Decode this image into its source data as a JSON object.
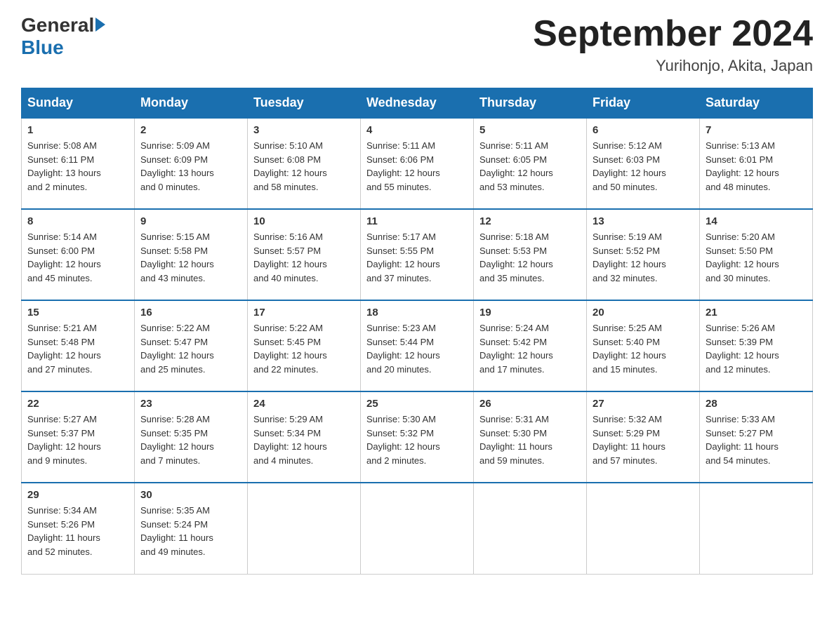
{
  "logo": {
    "general": "General",
    "blue": "Blue"
  },
  "title": "September 2024",
  "subtitle": "Yurihonjo, Akita, Japan",
  "days_of_week": [
    "Sunday",
    "Monday",
    "Tuesday",
    "Wednesday",
    "Thursday",
    "Friday",
    "Saturday"
  ],
  "weeks": [
    [
      {
        "day": "1",
        "info": "Sunrise: 5:08 AM\nSunset: 6:11 PM\nDaylight: 13 hours\nand 2 minutes."
      },
      {
        "day": "2",
        "info": "Sunrise: 5:09 AM\nSunset: 6:09 PM\nDaylight: 13 hours\nand 0 minutes."
      },
      {
        "day": "3",
        "info": "Sunrise: 5:10 AM\nSunset: 6:08 PM\nDaylight: 12 hours\nand 58 minutes."
      },
      {
        "day": "4",
        "info": "Sunrise: 5:11 AM\nSunset: 6:06 PM\nDaylight: 12 hours\nand 55 minutes."
      },
      {
        "day": "5",
        "info": "Sunrise: 5:11 AM\nSunset: 6:05 PM\nDaylight: 12 hours\nand 53 minutes."
      },
      {
        "day": "6",
        "info": "Sunrise: 5:12 AM\nSunset: 6:03 PM\nDaylight: 12 hours\nand 50 minutes."
      },
      {
        "day": "7",
        "info": "Sunrise: 5:13 AM\nSunset: 6:01 PM\nDaylight: 12 hours\nand 48 minutes."
      }
    ],
    [
      {
        "day": "8",
        "info": "Sunrise: 5:14 AM\nSunset: 6:00 PM\nDaylight: 12 hours\nand 45 minutes."
      },
      {
        "day": "9",
        "info": "Sunrise: 5:15 AM\nSunset: 5:58 PM\nDaylight: 12 hours\nand 43 minutes."
      },
      {
        "day": "10",
        "info": "Sunrise: 5:16 AM\nSunset: 5:57 PM\nDaylight: 12 hours\nand 40 minutes."
      },
      {
        "day": "11",
        "info": "Sunrise: 5:17 AM\nSunset: 5:55 PM\nDaylight: 12 hours\nand 37 minutes."
      },
      {
        "day": "12",
        "info": "Sunrise: 5:18 AM\nSunset: 5:53 PM\nDaylight: 12 hours\nand 35 minutes."
      },
      {
        "day": "13",
        "info": "Sunrise: 5:19 AM\nSunset: 5:52 PM\nDaylight: 12 hours\nand 32 minutes."
      },
      {
        "day": "14",
        "info": "Sunrise: 5:20 AM\nSunset: 5:50 PM\nDaylight: 12 hours\nand 30 minutes."
      }
    ],
    [
      {
        "day": "15",
        "info": "Sunrise: 5:21 AM\nSunset: 5:48 PM\nDaylight: 12 hours\nand 27 minutes."
      },
      {
        "day": "16",
        "info": "Sunrise: 5:22 AM\nSunset: 5:47 PM\nDaylight: 12 hours\nand 25 minutes."
      },
      {
        "day": "17",
        "info": "Sunrise: 5:22 AM\nSunset: 5:45 PM\nDaylight: 12 hours\nand 22 minutes."
      },
      {
        "day": "18",
        "info": "Sunrise: 5:23 AM\nSunset: 5:44 PM\nDaylight: 12 hours\nand 20 minutes."
      },
      {
        "day": "19",
        "info": "Sunrise: 5:24 AM\nSunset: 5:42 PM\nDaylight: 12 hours\nand 17 minutes."
      },
      {
        "day": "20",
        "info": "Sunrise: 5:25 AM\nSunset: 5:40 PM\nDaylight: 12 hours\nand 15 minutes."
      },
      {
        "day": "21",
        "info": "Sunrise: 5:26 AM\nSunset: 5:39 PM\nDaylight: 12 hours\nand 12 minutes."
      }
    ],
    [
      {
        "day": "22",
        "info": "Sunrise: 5:27 AM\nSunset: 5:37 PM\nDaylight: 12 hours\nand 9 minutes."
      },
      {
        "day": "23",
        "info": "Sunrise: 5:28 AM\nSunset: 5:35 PM\nDaylight: 12 hours\nand 7 minutes."
      },
      {
        "day": "24",
        "info": "Sunrise: 5:29 AM\nSunset: 5:34 PM\nDaylight: 12 hours\nand 4 minutes."
      },
      {
        "day": "25",
        "info": "Sunrise: 5:30 AM\nSunset: 5:32 PM\nDaylight: 12 hours\nand 2 minutes."
      },
      {
        "day": "26",
        "info": "Sunrise: 5:31 AM\nSunset: 5:30 PM\nDaylight: 11 hours\nand 59 minutes."
      },
      {
        "day": "27",
        "info": "Sunrise: 5:32 AM\nSunset: 5:29 PM\nDaylight: 11 hours\nand 57 minutes."
      },
      {
        "day": "28",
        "info": "Sunrise: 5:33 AM\nSunset: 5:27 PM\nDaylight: 11 hours\nand 54 minutes."
      }
    ],
    [
      {
        "day": "29",
        "info": "Sunrise: 5:34 AM\nSunset: 5:26 PM\nDaylight: 11 hours\nand 52 minutes."
      },
      {
        "day": "30",
        "info": "Sunrise: 5:35 AM\nSunset: 5:24 PM\nDaylight: 11 hours\nand 49 minutes."
      },
      {
        "day": "",
        "info": ""
      },
      {
        "day": "",
        "info": ""
      },
      {
        "day": "",
        "info": ""
      },
      {
        "day": "",
        "info": ""
      },
      {
        "day": "",
        "info": ""
      }
    ]
  ]
}
